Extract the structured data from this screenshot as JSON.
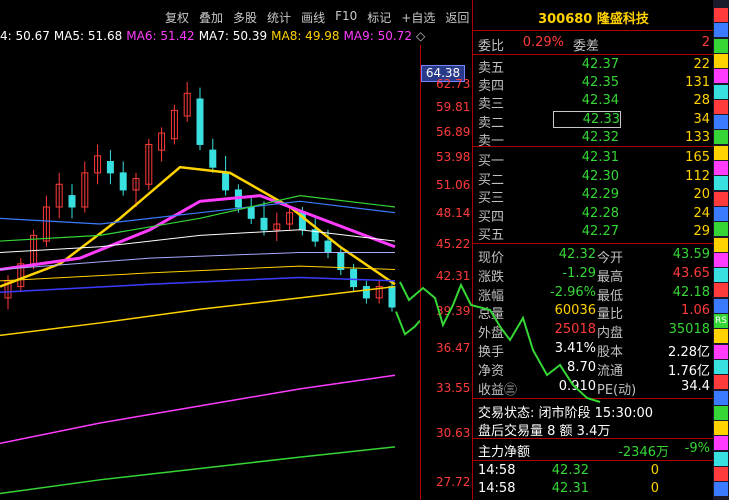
{
  "toolbar": [
    "复权",
    "叠加",
    "多股",
    "统计",
    "画线",
    "F10",
    "标记",
    "+自选",
    "返回"
  ],
  "ma": [
    {
      "label": "4: 50.67",
      "color": "#ffffff"
    },
    {
      "label": "MA5: 51.68",
      "color": "#ffffff"
    },
    {
      "label": "MA6: 51.42",
      "color": "#ff3cff"
    },
    {
      "label": "MA7: 50.39",
      "color": "#ffffff"
    },
    {
      "label": "MA8: 49.98",
      "color": "#ffd200"
    },
    {
      "label": "MA9: 50.72",
      "color": "#ff3cff"
    },
    {
      "label": "◇",
      "color": "#c0c0c0"
    }
  ],
  "axis": {
    "current_price": "64.38",
    "ticks": [
      "62.73",
      "59.81",
      "56.89",
      "53.98",
      "51.06",
      "48.14",
      "45.22",
      "42.31",
      "39.39",
      "36.47",
      "33.55",
      "30.63",
      "27.72"
    ]
  },
  "stock": {
    "code": "300680",
    "name": "隆盛科技"
  },
  "weibi": {
    "label": "委比",
    "value": "0.29%",
    "label2": "委差",
    "value2": "2"
  },
  "sell": [
    {
      "label": "卖五",
      "price": "42.37",
      "vol": "22"
    },
    {
      "label": "卖四",
      "price": "42.35",
      "vol": "131"
    },
    {
      "label": "卖三",
      "price": "42.34",
      "vol": "28"
    },
    {
      "label": "卖二",
      "price": "42.33",
      "vol": "34"
    },
    {
      "label": "卖一",
      "price": "42.32",
      "vol": "133"
    }
  ],
  "buy": [
    {
      "label": "买一",
      "price": "42.31",
      "vol": "165"
    },
    {
      "label": "买二",
      "price": "42.30",
      "vol": "112"
    },
    {
      "label": "买三",
      "price": "42.29",
      "vol": "20"
    },
    {
      "label": "买四",
      "price": "42.28",
      "vol": "24"
    },
    {
      "label": "买五",
      "price": "42.27",
      "vol": "29"
    }
  ],
  "quote": [
    {
      "l1": "现价",
      "v1": "42.32",
      "l2": "今开",
      "v2": "43.59",
      "c1": "green",
      "c2": "green"
    },
    {
      "l1": "涨跌",
      "v1": "-1.29",
      "l2": "最高",
      "v2": "43.65",
      "c1": "green",
      "c2": "red"
    },
    {
      "l1": "涨幅",
      "v1": "-2.96%",
      "l2": "最低",
      "v2": "42.18",
      "c1": "green",
      "c2": "green"
    },
    {
      "l1": "总量",
      "v1": "60036",
      "l2": "量比",
      "v2": "1.06",
      "c1": "yellow",
      "c2": "red"
    },
    {
      "l1": "外盘",
      "v1": "25018",
      "l2": "内盘",
      "v2": "35018",
      "c1": "red",
      "c2": "green"
    },
    {
      "l1": "换手",
      "v1": "3.41%",
      "l2": "股本",
      "v2": "2.28亿",
      "c1": "white",
      "c2": "white"
    },
    {
      "l1": "净资",
      "v1": "8.70",
      "l2": "流通",
      "v2": "1.76亿",
      "c1": "white",
      "c2": "white"
    },
    {
      "l1": "收益㊂",
      "v1": "0.910",
      "l2": "PE(动)",
      "v2": "34.4",
      "c1": "white",
      "c2": "white"
    }
  ],
  "status": {
    "line1": "交易状态: 闭市阶段 15:30:00",
    "line2": "盘后交易量 8 额 3.4万"
  },
  "net": {
    "label": "主力净额",
    "value": "-2346万",
    "pct": "-9%"
  },
  "ticks_list": [
    {
      "time": "14:58",
      "price": "42.32",
      "vol": "0"
    },
    {
      "time": "14:58",
      "price": "42.31",
      "vol": "0"
    }
  ],
  "side_icons": [
    "",
    "",
    "",
    "",
    "",
    "",
    "",
    "",
    "",
    "",
    "",
    "",
    "",
    "",
    "",
    "",
    "",
    "",
    "",
    "",
    "RS",
    "",
    "",
    "",
    "",
    "",
    "",
    "",
    "",
    "",
    "",
    ""
  ],
  "colors": {
    "up": "#ff3b3b",
    "down": "#35d635",
    "axis": "#b00000",
    "panel_border": "#b00000"
  }
}
